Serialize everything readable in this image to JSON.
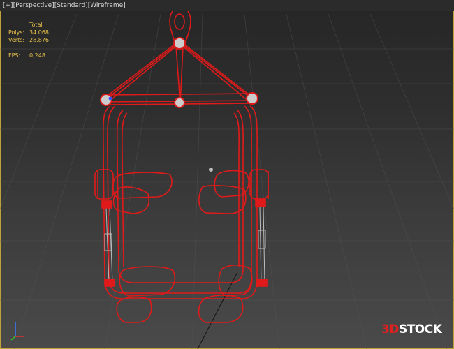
{
  "viewport": {
    "menu_plus": "[+]",
    "view_mode": "[Perspective]",
    "shading_preset": "[Standard]",
    "display_mode": "[Wireframe]"
  },
  "stats": {
    "header": "Total",
    "polys_label": "Polys:",
    "polys_value": "34.068",
    "verts_label": "Verts:",
    "verts_value": "28.876",
    "fps_label": "FPS:",
    "fps_value": "0,248"
  },
  "watermark": {
    "prefix": "3D",
    "suffix": "STOCK"
  },
  "colors": {
    "wireframe": "#e01a1a",
    "stats_text": "#e8c24a",
    "viewport_border": "#bfa23a",
    "grid_line": "#555555"
  },
  "icons": {
    "axis_gizmo": "xyz-axis-icon"
  }
}
